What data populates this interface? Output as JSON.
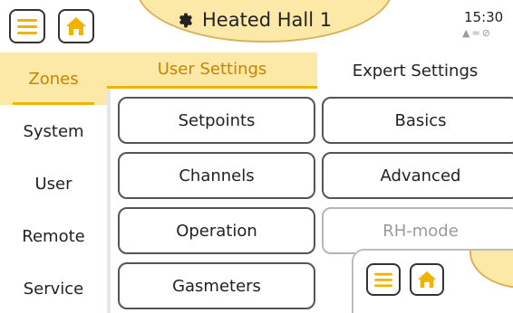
{
  "header": {
    "title": "Heated Hall 1",
    "time": "15:30",
    "status_icons": [
      "warning-icon",
      "wifi-icon",
      "no-signal-icon"
    ],
    "icons": [
      "menu-icon",
      "home-icon",
      "gear-icon"
    ]
  },
  "sidebar": {
    "items": [
      {
        "label": "Zones"
      },
      {
        "label": "System"
      },
      {
        "label": "User"
      },
      {
        "label": "Remote"
      },
      {
        "label": "Service"
      }
    ]
  },
  "tabs": [
    {
      "label": "User Settings"
    },
    {
      "label": "Expert Settings"
    }
  ],
  "buttons": {
    "setpoints": "Setpoints",
    "basics": "Basics",
    "channels": "Channels",
    "advanced": "Advanced",
    "operation": "Operation",
    "rh_mode": "RH-mode",
    "gasmeters": "Gasmeters"
  },
  "colors": {
    "accent": "#f0b400",
    "accent_bg": "#fde9a7",
    "accent_text": "#c78400"
  }
}
